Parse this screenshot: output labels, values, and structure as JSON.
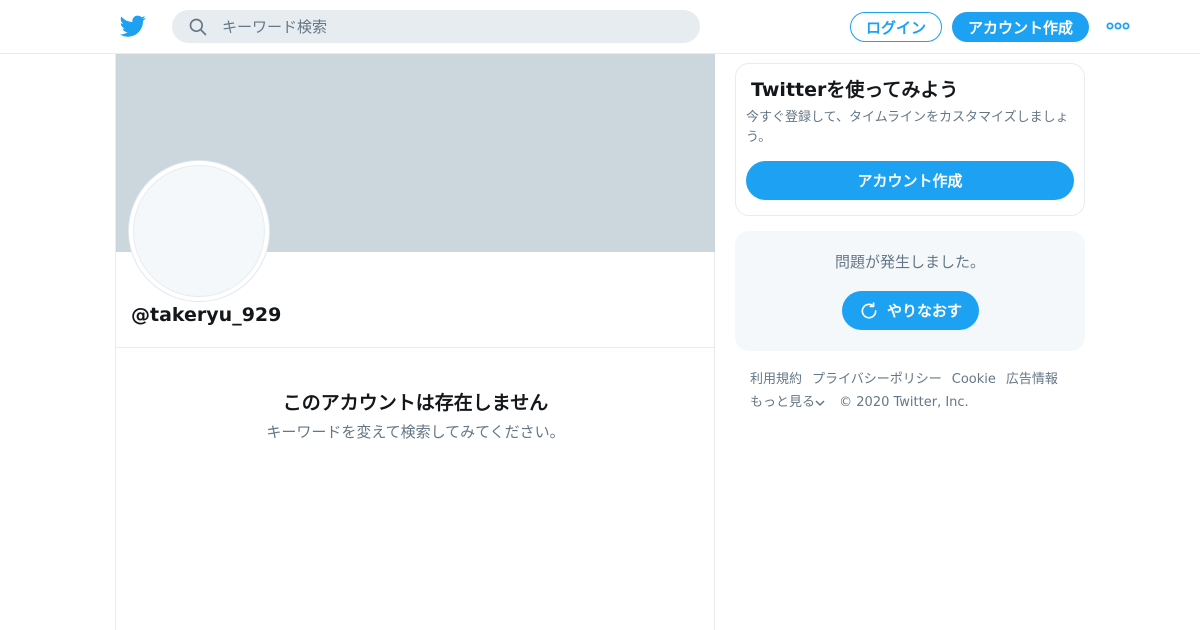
{
  "header": {
    "logo_icon": "twitter-bird-icon",
    "search_placeholder": "キーワード検索",
    "login_label": "ログイン",
    "signup_label": "アカウント作成",
    "more_icon": "more-dots-icon"
  },
  "profile": {
    "handle": "@takeryu_929",
    "empty_title": "このアカウントは存在しません",
    "empty_subtitle": "キーワードを変えて検索してみてください。"
  },
  "signup_card": {
    "title": "Twitterを使ってみよう",
    "description": "今すぐ登録して、タイムラインをカスタマイズしましょう。",
    "button_label": "アカウント作成"
  },
  "error_box": {
    "message": "問題が発生しました。",
    "retry_label": "やりなおす",
    "retry_icon": "refresh-icon"
  },
  "footer": {
    "links": [
      "利用規約",
      "プライバシーポリシー",
      "Cookie",
      "広告情報"
    ],
    "more_label": "もっと見る",
    "copyright": "© 2020 Twitter, Inc."
  },
  "colors": {
    "brand": "#1da1f2",
    "banner": "#ccd6dd",
    "secondary_text": "#657786",
    "border": "#e6ecf0"
  }
}
